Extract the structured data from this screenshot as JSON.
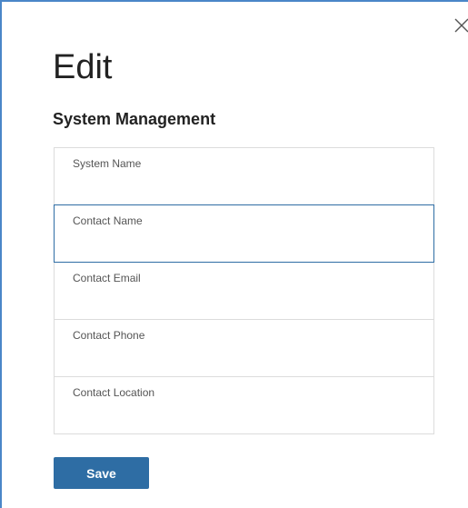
{
  "dialog": {
    "title": "Edit",
    "subtitle": "System Management",
    "close_icon": "close-icon",
    "accent_color": "#4a86c8"
  },
  "form": {
    "fields": [
      {
        "label": "System Name",
        "value": "",
        "focused": false
      },
      {
        "label": "Contact Name",
        "value": "",
        "focused": true
      },
      {
        "label": "Contact Email",
        "value": "",
        "focused": false
      },
      {
        "label": "Contact Phone",
        "value": "",
        "focused": false
      },
      {
        "label": "Contact Location",
        "value": "",
        "focused": false
      }
    ]
  },
  "actions": {
    "save_label": "Save",
    "save_color": "#2e6da4"
  }
}
